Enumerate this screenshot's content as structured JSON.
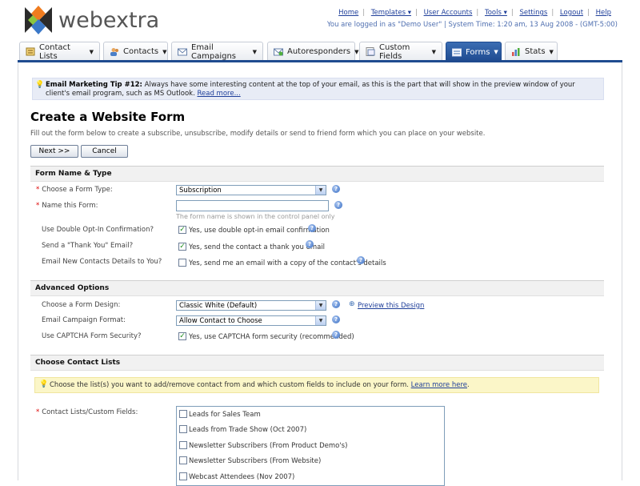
{
  "brand": {
    "logo_text": "webextra"
  },
  "header": {
    "links": [
      "Home",
      "Templates ▾",
      "User Accounts",
      "Tools ▾",
      "Settings",
      "Logout",
      "Help"
    ],
    "login_info": "You are logged in as \"Demo User\" | System Time: 1:20 am, 13 Aug 2008 - (GMT-5:00)"
  },
  "tabs": [
    {
      "label": "Contact Lists",
      "active": false
    },
    {
      "label": "Contacts",
      "active": false
    },
    {
      "label": "Email Campaigns",
      "active": false
    },
    {
      "label": "Autoresponders",
      "active": false
    },
    {
      "label": "Custom Fields",
      "active": false
    },
    {
      "label": "Forms",
      "active": true
    },
    {
      "label": "Stats",
      "active": false
    }
  ],
  "tip": {
    "title": "Email Marketing Tip #12:",
    "text": "Always have some interesting content at the top of your email, as this is the part that will show in the preview window of your client's email program, such as MS Outlook.",
    "read_more": "Read more..."
  },
  "page": {
    "title": "Create a Website Form",
    "intro": "Fill out the form below to create a subscribe, unsubscribe, modify details or send to friend form which you can place on your website.",
    "next_button": "Next >>",
    "cancel_button": "Cancel"
  },
  "form_name_type": {
    "heading": "Form Name & Type",
    "form_type_label": "Choose a Form Type:",
    "form_type_value": "Subscription",
    "name_label": "Name this Form:",
    "name_value": "",
    "name_hint": "The form name is shown in the control panel only",
    "double_optin_label": "Use Double Opt-In Confirmation?",
    "double_optin_text": "Yes, use double opt-in email confirmation",
    "double_optin_checked": true,
    "thankyou_label": "Send a \"Thank You\" Email?",
    "thankyou_text": "Yes, send the contact a thank you email",
    "thankyou_checked": true,
    "notify_label": "Email New Contacts Details to You?",
    "notify_text": "Yes, send me an email with a copy of the contact's details",
    "notify_checked": false
  },
  "advanced": {
    "heading": "Advanced Options",
    "design_label": "Choose a Form Design:",
    "design_value": "Classic White (Default)",
    "preview_link": "Preview this Design",
    "format_label": "Email Campaign Format:",
    "format_value": "Allow Contact to Choose",
    "captcha_label": "Use CAPTCHA Form Security?",
    "captcha_text": "Yes, use CAPTCHA form security (recommended)",
    "captcha_checked": true
  },
  "contact_lists": {
    "heading": "Choose Contact Lists",
    "tip_text": "Choose the list(s) you want to add/remove contact from and which custom fields to include on your form.",
    "tip_link": "Learn more here",
    "tip_end": ".",
    "field_label": "Contact Lists/Custom Fields:",
    "items": [
      "Leads for Sales Team",
      "Leads from Trade Show (Oct 2007)",
      "Newsletter Subscribers (From Product Demo's)",
      "Newsletter Subscribers (From Website)",
      "Webcast Attendees (Nov 2007)"
    ]
  }
}
